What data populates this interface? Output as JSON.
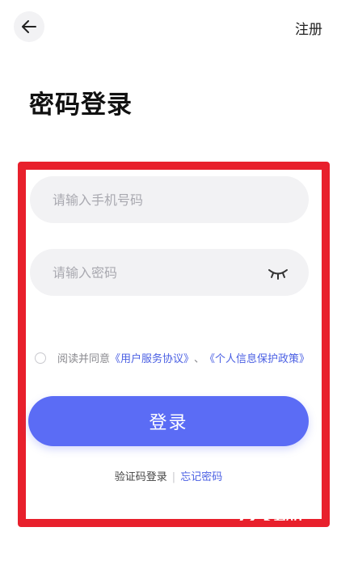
{
  "header": {
    "back_icon": "arrow-left-icon",
    "register_label": "注册"
  },
  "title": "密码登录",
  "form": {
    "phone_placeholder": "请输入手机号码",
    "phone_value": "",
    "password_placeholder": "请输入密码",
    "password_value": "",
    "password_toggle_icon": "eye-closed-icon"
  },
  "agreement": {
    "prefix": "阅读并同意",
    "user_agreement": "《用户服务协议》",
    "separator": "、",
    "privacy_policy": "《个人信息保护政策》",
    "checked": false
  },
  "login_button": "登录",
  "alternatives": {
    "sms_login": "验证码登录",
    "divider": "|",
    "forgot_password": "忘记密码"
  },
  "watermark": "7Z下载站",
  "colors": {
    "accent": "#5b6cf5",
    "link": "#4a5fe3",
    "highlight_frame": "#e8202c",
    "field_bg": "#f2f2f4"
  }
}
